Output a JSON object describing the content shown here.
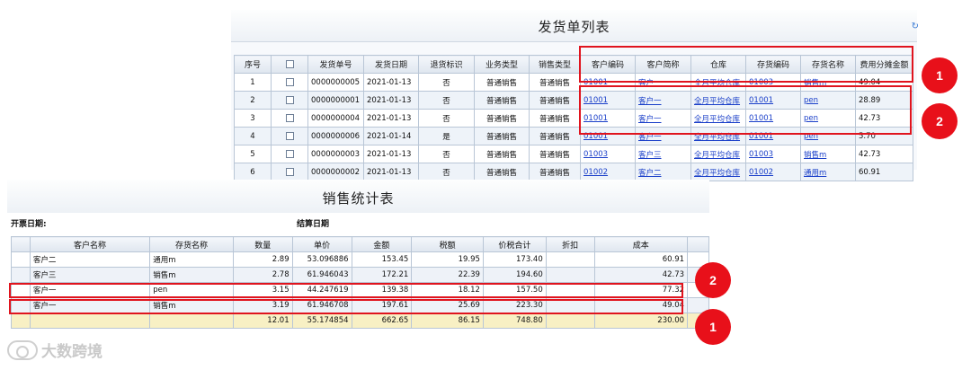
{
  "delivery_list": {
    "title": "发货单列表",
    "columns": [
      "序号",
      "",
      "发货单号",
      "发货日期",
      "退货标识",
      "业务类型",
      "销售类型",
      "客户编码",
      "客户简称",
      "仓库",
      "存货编码",
      "存货名称",
      "费用分摊金额"
    ],
    "rows": [
      {
        "idx": "1",
        "no": "0000000005",
        "date": "2021-01-13",
        "ret": "否",
        "biz": "普通销售",
        "sale": "普通销售",
        "cust_code": "01001",
        "cust": "客户一",
        "wh": "全月平均仓库",
        "inv_code": "01003",
        "inv": "销售m",
        "fee": "49.04"
      },
      {
        "idx": "2",
        "no": "0000000001",
        "date": "2021-01-13",
        "ret": "否",
        "biz": "普通销售",
        "sale": "普通销售",
        "cust_code": "01001",
        "cust": "客户一",
        "wh": "全月平均仓库",
        "inv_code": "01001",
        "inv": "pen",
        "fee": "28.89"
      },
      {
        "idx": "3",
        "no": "0000000004",
        "date": "2021-01-13",
        "ret": "否",
        "biz": "普通销售",
        "sale": "普通销售",
        "cust_code": "01001",
        "cust": "客户一",
        "wh": "全月平均仓库",
        "inv_code": "01001",
        "inv": "pen",
        "fee": "42.73"
      },
      {
        "idx": "4",
        "no": "0000000006",
        "date": "2021-01-14",
        "ret": "是",
        "biz": "普通销售",
        "sale": "普通销售",
        "cust_code": "01001",
        "cust": "客户一",
        "wh": "全月平均仓库",
        "inv_code": "01001",
        "inv": "pen",
        "fee": "5.70"
      },
      {
        "idx": "5",
        "no": "0000000003",
        "date": "2021-01-13",
        "ret": "否",
        "biz": "普通销售",
        "sale": "普通销售",
        "cust_code": "01003",
        "cust": "客户三",
        "wh": "全月平均仓库",
        "inv_code": "01003",
        "inv": "销售m",
        "fee": "42.73"
      },
      {
        "idx": "6",
        "no": "0000000002",
        "date": "2021-01-13",
        "ret": "否",
        "biz": "普通销售",
        "sale": "普通销售",
        "cust_code": "01002",
        "cust": "客户二",
        "wh": "全月平均仓库",
        "inv_code": "01002",
        "inv": "通用m",
        "fee": "60.91"
      }
    ]
  },
  "sales_stats": {
    "title": "销售统计表",
    "invoice_date_label": "开票日期:",
    "settle_date_label": "结算日期",
    "columns": [
      "",
      "客户名称",
      "存货名称",
      "数量",
      "单价",
      "金额",
      "税额",
      "价税合计",
      "折扣",
      "成本"
    ],
    "rows": [
      {
        "cust": "客户二",
        "inv": "通用m",
        "qty": "2.89",
        "price": "53.096886",
        "amt": "153.45",
        "tax": "19.95",
        "total": "173.40",
        "disc": "",
        "cost": "60.91"
      },
      {
        "cust": "客户三",
        "inv": "销售m",
        "qty": "2.78",
        "price": "61.946043",
        "amt": "172.21",
        "tax": "22.39",
        "total": "194.60",
        "disc": "",
        "cost": "42.73"
      },
      {
        "cust": "客户一",
        "inv": "pen",
        "qty": "3.15",
        "price": "44.247619",
        "amt": "139.38",
        "tax": "18.12",
        "total": "157.50",
        "disc": "",
        "cost": "77.32"
      },
      {
        "cust": "客户一",
        "inv": "销售m",
        "qty": "3.19",
        "price": "61.946708",
        "amt": "197.61",
        "tax": "25.69",
        "total": "223.30",
        "disc": "",
        "cost": "49.04"
      }
    ],
    "totals": {
      "qty": "12.01",
      "price": "55.174854",
      "amt": "662.65",
      "tax": "86.15",
      "total": "748.80",
      "disc": "",
      "cost": "230.00"
    }
  },
  "annotations": {
    "badge_1": "1",
    "badge_2": "2",
    "accent": "#e0141e"
  },
  "watermark": {
    "text": "大数跨境"
  }
}
